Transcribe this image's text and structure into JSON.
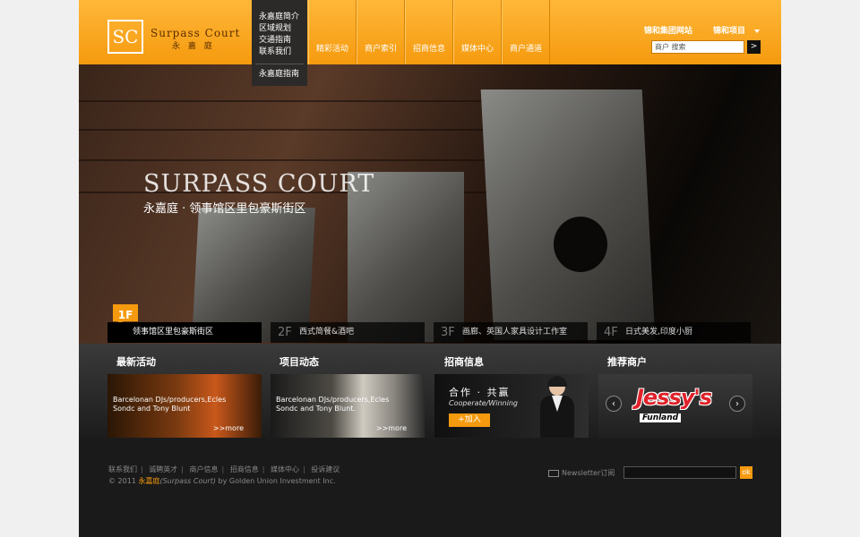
{
  "brand": {
    "logo_mark": "SC",
    "name_en": "Surpass Court",
    "name_cn": "永 嘉 庭"
  },
  "dropdown": {
    "items": [
      "永嘉庭简介",
      "区域规划",
      "交通指南",
      "联系我们"
    ],
    "footer": "永嘉庭指南"
  },
  "nav": {
    "items": [
      "精彩活动",
      "商户索引",
      "招商信息",
      "媒体中心",
      "商户通道"
    ]
  },
  "top_links": {
    "group_site": "锦和集团网站",
    "projects": "锦和项目"
  },
  "search": {
    "placeholder": "商户 搜索",
    "button": ">"
  },
  "banner": {
    "title": "SURPASS COURT",
    "subtitle": "永嘉庭 · 领事馆区里包豪斯街区"
  },
  "floors": [
    {
      "num": "1F",
      "label": "领事馆区里包豪斯街区"
    },
    {
      "num": "2F",
      "label": "西式简餐&酒吧"
    },
    {
      "num": "3F",
      "label": "画廊、英国人家具设计工作室"
    },
    {
      "num": "4F",
      "label": "日式美发,印度小厨"
    }
  ],
  "sections": {
    "events": {
      "title": "最新活动",
      "text": "Barcelonan DJs/producers,Ecles Sondc and Tony Blunt",
      "more": ">>more"
    },
    "projects": {
      "title": "项目动态",
      "text": "Barcelonan DJs/producers,Ecles Sondc and Tony Blunt.",
      "more": ">>more"
    },
    "leasing": {
      "title": "招商信息",
      "coop_cn": "合作 · 共赢",
      "coop_en": "Cooperate/Winning",
      "join": "+加入"
    },
    "tenants": {
      "title": "推荐商户",
      "logo": "Jessy's",
      "logo_sub": "Funland"
    }
  },
  "footer": {
    "links": [
      "联系我们",
      "诚聘英才",
      "商户信息",
      "招商信息",
      "媒体中心",
      "投诉建议"
    ],
    "copyright_prefix": "© 2011",
    "copyright_brand": "永嘉庭",
    "copyright_brand_en": "(Surpass Court)",
    "copyright_suffix": "by Golden Union Investment Inc.",
    "newsletter_label": "Newsletter订阅",
    "ok": "ok"
  },
  "colors": {
    "accent": "#f59a0e",
    "dark": "#161616"
  }
}
